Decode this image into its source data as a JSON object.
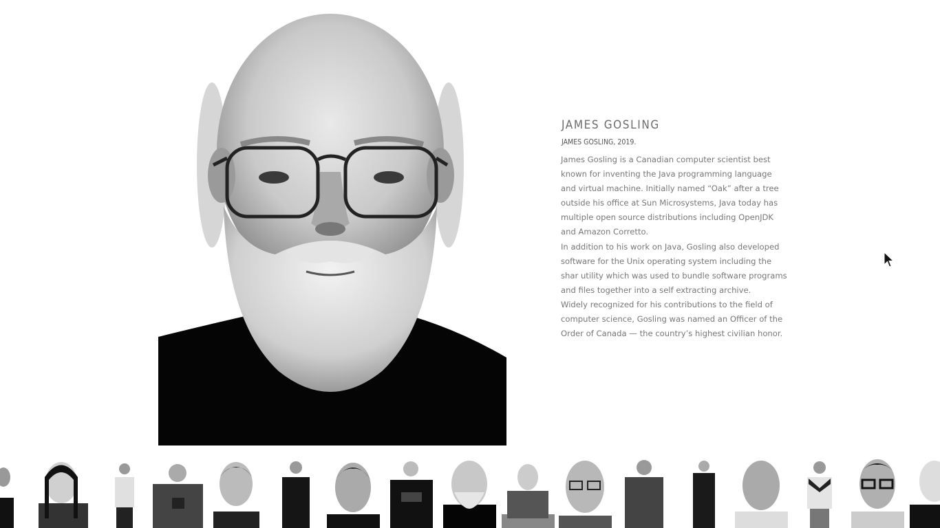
{
  "person": {
    "name": "JAMES GOSLING",
    "caption": "JAMES GOSLING, 2019.",
    "bio": [
      "James Gosling is a Canadian computer scientist best known for inventing the Java programming language and virtual machine. Initially named “Oak” after a tree outside his office at Sun Microsystems, Java today has multiple open source distributions including OpenJDK and Amazon Corretto.",
      "In addition to his work on Java, Gosling also developed software for the Unix operating system including the shar utility which was used to bundle software programs and files together into a self extracting archive.",
      "Widely recognized for his contributions to the field of computer science, Gosling was named an Officer of the Order of Canada — the country’s highest civilian honor."
    ]
  },
  "portrait": {
    "icon": "portrait-photo",
    "style": "black-and-white"
  },
  "thumbnails_label": "portrait thumbnails",
  "colors": {
    "background": "#ffffff",
    "text": "#777777",
    "title": "#6b6b6b"
  }
}
